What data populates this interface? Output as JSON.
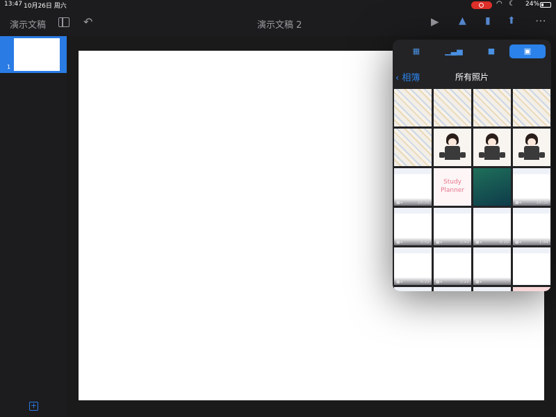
{
  "status_bar": {
    "time": "13:47",
    "date": "10月26日 周六",
    "battery": "24%"
  },
  "toolbar": {
    "documents_label": "演示文稿",
    "doc_title": "演示文稿 2"
  },
  "navigator": {
    "slide_number": "1"
  },
  "media_popover": {
    "tabs": [
      "table-icon",
      "chart-icon",
      "shape-icon",
      "media-icon"
    ],
    "active_tab": "media-icon",
    "back_label": "相簿",
    "title": "所有照片",
    "photos": [
      {
        "kind": "sticker-sheet"
      },
      {
        "kind": "sticker-sheet"
      },
      {
        "kind": "sticker-sheet"
      },
      {
        "kind": "sticker-sheet"
      },
      {
        "kind": "sticker-sheet"
      },
      {
        "kind": "girl-illustration"
      },
      {
        "kind": "girl-illustration"
      },
      {
        "kind": "girl-illustration"
      },
      {
        "kind": "video",
        "duration": "10:31"
      },
      {
        "kind": "study-planner",
        "text": "Study Planner"
      },
      {
        "kind": "ipad-home"
      },
      {
        "kind": "video",
        "duration": "10:31"
      },
      {
        "kind": "video",
        "duration": "3:52"
      },
      {
        "kind": "video",
        "duration": "3:43"
      },
      {
        "kind": "video",
        "duration": "4:10"
      },
      {
        "kind": "video",
        "duration": "1:44"
      },
      {
        "kind": "video",
        "duration": "4:33"
      },
      {
        "kind": "video",
        "duration": "3:22"
      },
      {
        "kind": "video",
        "duration": ""
      },
      {
        "kind": "screenshot"
      },
      {
        "kind": "screenshot"
      },
      {
        "kind": "screenshot"
      },
      {
        "kind": "screenshot"
      },
      {
        "kind": "pink-screenshot"
      }
    ]
  },
  "colors": {
    "accent": "#2a82ea",
    "record": "#e0302a",
    "slide_bg": "#ffffff"
  }
}
